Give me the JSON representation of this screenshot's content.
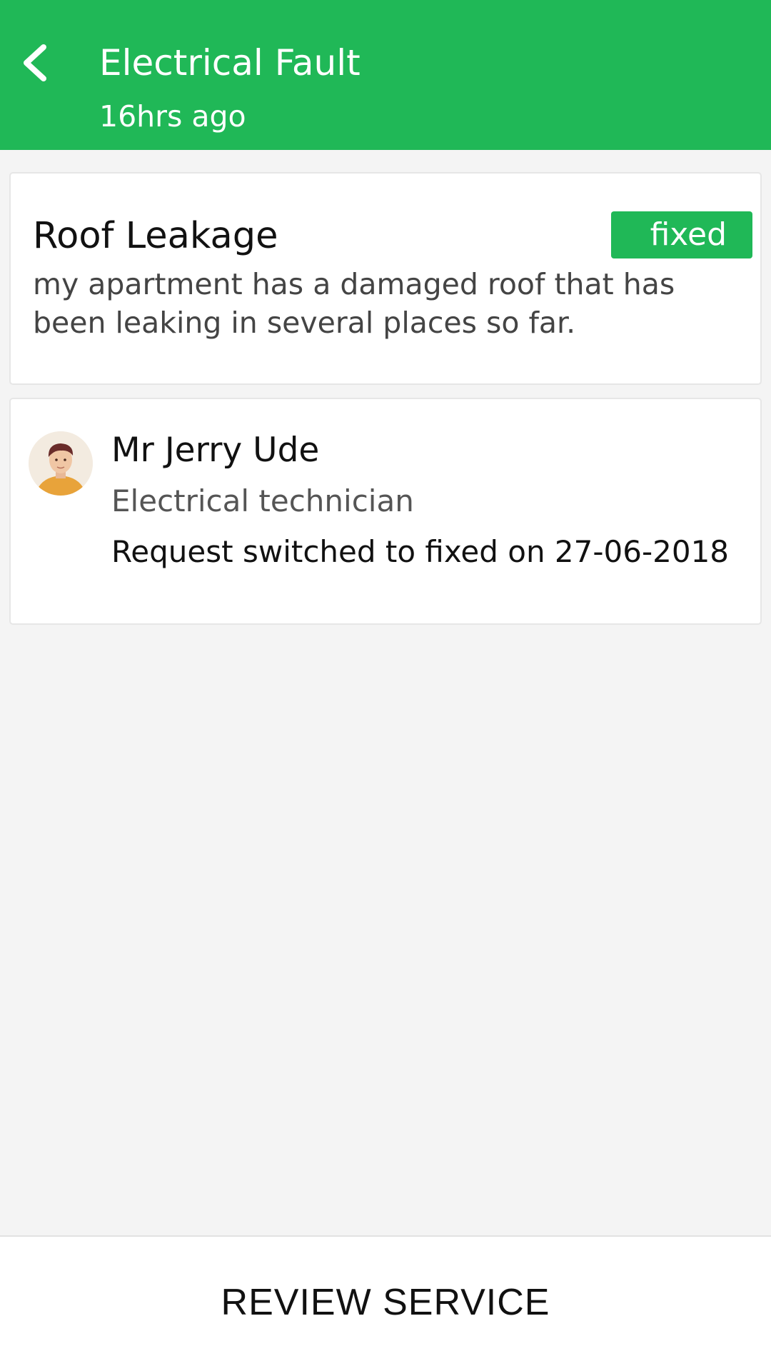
{
  "header": {
    "title": "Electrical Fault",
    "subtitle": "16hrs ago",
    "back_icon": "chevron-left-icon"
  },
  "request": {
    "title": "Roof Leakage",
    "status": "fixed",
    "description": "my apartment has a damaged roof that has been leaking in several places so far."
  },
  "technician": {
    "avatar_icon": "male-avatar-icon",
    "name": "Mr Jerry Ude",
    "role": "Electrical technician",
    "status_text": "Request switched to fixed on 27-06-2018"
  },
  "bottom_bar": {
    "review_label": "REVIEW SERVICE"
  },
  "colors": {
    "brand_green": "#20b857",
    "background": "#f4f4f4",
    "card": "#ffffff"
  }
}
